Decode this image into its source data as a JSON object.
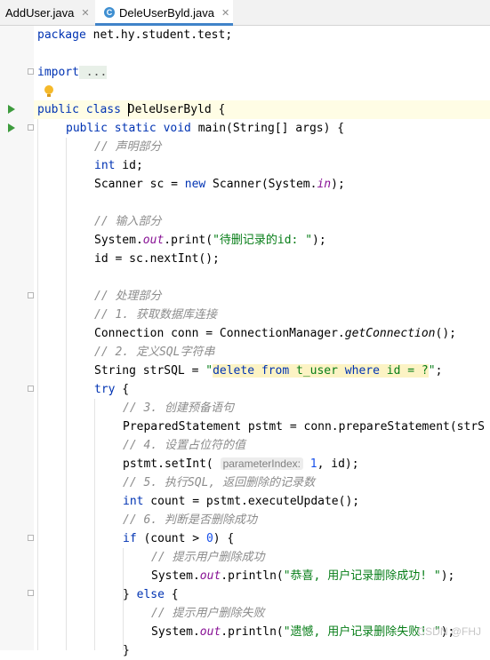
{
  "tabs": [
    {
      "label": "AddUser.java",
      "active": false
    },
    {
      "label": "DeleUserByld.java",
      "active": true
    }
  ],
  "tab_icon_letter": "C",
  "code": {
    "l1": [
      "package ",
      "net.hy.student.test;"
    ],
    "l2": [
      "import",
      " ..."
    ],
    "l3": [
      "public class ",
      "DeleUserByld",
      " {"
    ],
    "l4": [
      "public static void ",
      "main",
      "(String[] args) {"
    ],
    "l5": "// 声明部分",
    "l6": [
      "int",
      " id;"
    ],
    "l7": [
      "Scanner sc = ",
      "new",
      " Scanner(System.",
      "in",
      ");"
    ],
    "l8": "// 输入部分",
    "l9": [
      "System.",
      "out",
      ".print(",
      "\"待删记录的id: \"",
      ");"
    ],
    "l10": "id = sc.nextInt();",
    "l11": "// 处理部分",
    "l12": "// 1. 获取数据库连接",
    "l13": [
      "Connection conn = ConnectionManager.",
      "getConnection",
      "();"
    ],
    "l14": "// 2. 定义SQL字符串",
    "l15": [
      "String strSQL = ",
      "\"",
      "delete ",
      "from",
      " t_user ",
      "where",
      " id = ?",
      "\"",
      ";"
    ],
    "l16": [
      "try",
      " {"
    ],
    "l17": "// 3. 创建预备语句",
    "l18": "PreparedStatement pstmt = conn.prepareStatement(strS",
    "l19": "// 4. 设置占位符的值",
    "l20": [
      "pstmt.setInt( ",
      "parameterIndex:",
      " 1",
      ", id);"
    ],
    "l21": "// 5. 执行SQL, 返回删除的记录数",
    "l22": [
      "int",
      " count = pstmt.executeUpdate();"
    ],
    "l23": "// 6. 判断是否删除成功",
    "l24": [
      "if",
      " (count > ",
      "0",
      ") {"
    ],
    "l25": "// 提示用户删除成功",
    "l26": [
      "System.",
      "out",
      ".println(",
      "\"恭喜, 用户记录删除成功! \"",
      ");"
    ],
    "l27": [
      "} ",
      "else",
      " {"
    ],
    "l28": "// 提示用户删除失败",
    "l29": [
      "System.",
      "out",
      ".println(",
      "\"遗憾, 用户记录删除失败! \"",
      ");"
    ],
    "l30": "}"
  },
  "watermark": "CSDN @FHJ",
  "colors": {
    "keyword": "#0033b3",
    "string": "#067d17",
    "comment": "#8c8c8c",
    "static_field": "#871094",
    "number": "#1750eb",
    "run_icon": "#3d9b3d",
    "active_tab_underline": "#4083c9"
  },
  "icons": [
    "class-c-icon",
    "close-icon",
    "run-icon",
    "fold-icon",
    "intention-bulb-icon"
  ]
}
